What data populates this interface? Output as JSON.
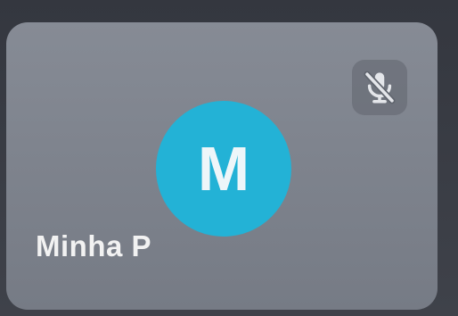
{
  "participant": {
    "name": "Minha P",
    "initial": "M",
    "avatar_color": "#23b2d6",
    "mic_status_icon": "microphone-off-icon"
  }
}
